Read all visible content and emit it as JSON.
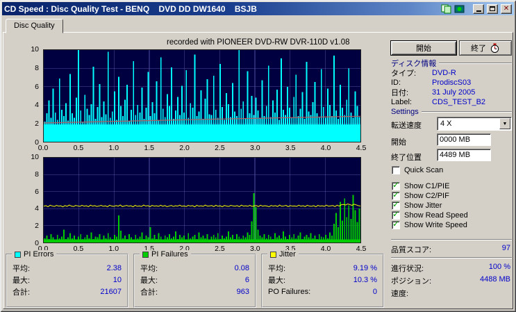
{
  "window": {
    "title": "CD Speed : Disc Quality Test - BENQ    DVD DD DW1640    BSJB",
    "controls": {
      "minimize": "minimize",
      "maximize": "maximize",
      "close": "✕"
    },
    "title_icons": [
      "pages-icon",
      "disc-drive-icon"
    ]
  },
  "tab": {
    "label": "Disc Quality"
  },
  "recorded_with": "recorded with PIONEER DVD-RW  DVR-110D v1.08",
  "buttons": {
    "start": "開始",
    "exit": "終了"
  },
  "disc_info": {
    "header": "ディスク情報",
    "rows": [
      {
        "label": "タイプ:",
        "value": "DVD-R"
      },
      {
        "label": "ID:",
        "value": "ProdiscS03"
      },
      {
        "label": "日付:",
        "value": "31 July 2005"
      },
      {
        "label": "Label:",
        "value": "CDS_TEST_B2"
      }
    ]
  },
  "settings": {
    "header": "Settings",
    "speed_label": "転送速度",
    "speed_value": "4 X",
    "start_label": "開始",
    "start_value": "0000 MB",
    "end_label": "終了位置",
    "end_value": "4489 MB",
    "checkboxes": [
      {
        "label": "Quick Scan",
        "checked": false
      },
      {
        "label": "Show C1/PIE",
        "checked": true
      },
      {
        "label": "Show C2/PIF",
        "checked": true
      },
      {
        "label": "Show Jitter",
        "checked": true
      },
      {
        "label": "Show Read Speed",
        "checked": true
      },
      {
        "label": "Show Write Speed",
        "checked": true
      }
    ]
  },
  "quality": {
    "label": "品質スコア:",
    "value": "97"
  },
  "status": {
    "rows": [
      {
        "label": "進行状況:",
        "value": "100 %"
      },
      {
        "label": "ポジション:",
        "value": "4488 MB"
      },
      {
        "label": "速度:",
        "value": ""
      }
    ]
  },
  "stats_boxes": [
    {
      "title": "PI Errors",
      "color": "#00ffff",
      "rows": [
        [
          "平均:",
          "2.38"
        ],
        [
          "最大:",
          "10"
        ],
        [
          "合計:",
          "21607"
        ]
      ]
    },
    {
      "title": "PI Failures",
      "color": "#00cc00",
      "rows": [
        [
          "平均:",
          "0.08"
        ],
        [
          "最大:",
          "6"
        ],
        [
          "合計:",
          "963"
        ]
      ]
    },
    {
      "title": "Jitter",
      "color": "#ffff00",
      "rows": [
        [
          "平均:",
          "9.19 %"
        ],
        [
          "最大:",
          "10.3 %"
        ],
        [
          "PO Failures:",
          "0"
        ]
      ]
    }
  ],
  "chart_data": [
    {
      "type": "bar",
      "title": "PI Errors (C1/PIE) with write speed line",
      "xlim": [
        0,
        4.5
      ],
      "ylim": [
        0,
        10
      ],
      "x_ticks": [
        "0.0",
        "0.5",
        "1.0",
        "1.5",
        "2.0",
        "2.5",
        "3.0",
        "3.5",
        "4.0",
        "4.5"
      ],
      "y_ticks": [
        "10",
        "8",
        "6",
        "4",
        "2",
        "0"
      ],
      "bg": "#000040",
      "grid": "#5050a0",
      "bar_color": "#00ffff",
      "base_level": 1.9,
      "values": [
        2.2,
        3.1,
        4.5,
        2.6,
        5.8,
        3.2,
        2.4,
        6.9,
        3.5,
        2.8,
        4.2,
        2.3,
        7.4,
        3.1,
        2.6,
        4.8,
        10,
        3.4,
        2.2,
        5.1,
        3.6,
        2.9,
        4.1,
        8.2,
        2.5,
        3.8,
        6.3,
        2.7,
        4.4,
        3.0,
        9.8,
        2.6,
        3.3,
        5.5,
        2.4,
        7.1,
        3.9,
        2.8,
        4.6,
        6.2,
        2.3,
        3.5,
        8.8,
        2.9,
        4.0,
        3.2,
        5.9,
        2.5,
        3.7,
        7.6,
        2.8,
        4.3,
        3.1,
        6.6,
        2.4,
        9.2,
        3.6,
        2.7,
        5.2,
        3.9,
        8.1,
        2.5,
        3.4,
        4.9,
        2.9,
        6.1,
        3.2,
        7.8,
        2.6,
        4.2,
        3.7,
        9.5,
        2.8,
        3.3,
        5.6,
        2.5,
        4.7,
        6.8,
        3.0,
        2.9,
        7.2,
        3.5,
        2.6,
        8.5,
        3.8,
        2.4,
        5.3,
        4.1,
        2.7,
        6.4,
        3.3,
        2.8,
        10,
        3.6,
        4.4,
        2.5,
        7.7,
        3.1,
        5.0,
        2.9,
        4.8,
        3.4,
        2.6,
        6.7,
        2.8,
        3.9,
        8.3,
        2.7,
        4.5,
        3.2,
        5.7,
        2.4,
        9.1,
        3.5,
        2.9,
        6.0,
        3.7,
        2.6,
        4.9,
        7.3,
        2.8,
        3.6,
        5.4,
        2.5,
        8.7,
        3.3,
        2.9,
        4.3,
        6.5,
        3.1,
        2.7,
        7.9,
        3.8,
        2.6,
        5.8,
        4.0,
        2.8,
        9.4,
        3.4,
        2.5,
        6.2,
        3.7,
        2.9,
        4.6,
        8.0,
        3.2,
        2.6,
        5.5,
        3.9,
        2.7
      ],
      "speed_line": {
        "name": "Write Speed",
        "color": "#b06060",
        "points": [
          [
            0,
            2.05
          ],
          [
            2.25,
            2.44
          ],
          [
            4.5,
            2.78
          ]
        ]
      }
    },
    {
      "type": "bar",
      "title": "PI Failures (C2/PIF) with Jitter line",
      "xlim": [
        0,
        4.5
      ],
      "ylim": [
        0,
        10
      ],
      "x_ticks": [
        "0.0",
        "0.5",
        "1.0",
        "1.5",
        "2.0",
        "2.5",
        "3.0",
        "3.5",
        "4.0",
        "4.5"
      ],
      "y_ticks": [
        "10",
        "8",
        "6",
        "4",
        "2",
        "0"
      ],
      "bg": "#000040",
      "grid": "#5050a0",
      "bar_color": "#00cc00",
      "base_level": 0.35,
      "values": [
        0.5,
        0.8,
        0.4,
        1.0,
        0.6,
        0.3,
        0.9,
        0.5,
        0.7,
        1.5,
        0.4,
        0.6,
        1.1,
        0.5,
        0.8,
        0.3,
        0.7,
        1.0,
        0.4,
        0.6,
        0.9,
        0.5,
        1.2,
        0.4,
        0.7,
        0.6,
        1.0,
        0.3,
        0.8,
        0.5,
        1.1,
        0.6,
        0.4,
        0.9,
        0.7,
        3.2,
        1.4,
        0.5,
        0.8,
        0.4,
        1.0,
        0.6,
        0.3,
        0.9,
        0.5,
        0.7,
        1.2,
        0.4,
        0.8,
        0.6,
        1.8,
        0.5,
        0.9,
        0.4,
        1.1,
        0.7,
        0.3,
        0.8,
        0.6,
        1.0,
        0.5,
        0.7,
        1.3,
        0.4,
        0.9,
        0.6,
        0.8,
        0.3,
        1.1,
        0.5,
        0.7,
        0.9,
        0.4,
        1.2,
        0.6,
        0.8,
        0.5,
        1.0,
        0.3,
        0.7,
        0.9,
        0.6,
        1.1,
        0.4,
        0.8,
        0.5,
        0.7,
        1.3,
        0.6,
        0.9,
        0.4,
        1.0,
        0.7,
        0.5,
        0.8,
        0.6,
        1.2,
        0.9,
        2.5,
        5.8,
        4.2,
        1.5,
        0.8,
        0.6,
        1.0,
        0.5,
        0.9,
        0.7,
        0.4,
        1.1,
        0.6,
        0.8,
        0.5,
        1.3,
        0.7,
        0.4,
        0.9,
        0.6,
        1.0,
        0.5,
        0.8,
        1.2,
        0.4,
        0.7,
        0.9,
        0.6,
        1.1,
        0.5,
        0.8,
        0.4,
        1.0,
        0.7,
        0.6,
        0.9,
        0.5,
        1.2,
        0.8,
        2.2,
        3.5,
        1.8,
        4.8,
        2.6,
        5.2,
        3.0,
        4.4,
        2.8,
        5.6,
        3.8,
        2.4,
        4.0
      ],
      "line": {
        "name": "Jitter",
        "color": "#ffff00",
        "values": [
          4.28,
          4.35,
          4.22,
          4.4,
          4.31,
          4.25,
          4.38,
          4.29,
          4.33,
          4.21,
          4.36,
          4.27,
          4.42,
          4.3,
          4.24,
          4.37,
          4.32,
          4.26,
          4.39,
          4.28,
          4.34,
          4.23,
          4.41,
          4.29,
          4.35,
          4.25,
          4.31,
          4.38,
          4.27,
          4.33,
          4.22,
          4.4,
          4.3,
          4.26,
          4.36,
          4.29,
          4.43,
          4.24,
          4.32,
          4.37,
          4.28,
          4.34,
          4.21,
          4.39,
          4.27,
          4.31,
          4.25,
          4.42,
          4.3,
          4.35,
          4.23,
          4.38,
          4.29,
          4.33,
          4.26,
          4.4,
          4.28,
          4.36,
          4.22,
          4.31,
          4.37,
          4.25,
          4.34,
          4.29,
          4.41,
          4.27,
          4.32,
          4.24,
          4.38,
          4.3,
          4.35,
          4.21,
          4.39,
          4.28,
          4.33,
          4.26,
          4.42,
          4.29,
          4.31,
          4.36,
          4.24,
          4.4,
          4.27,
          4.34,
          4.22,
          4.37,
          4.3,
          4.25,
          4.38,
          4.32,
          4.28,
          4.35,
          4.23,
          4.41,
          4.29,
          4.33,
          4.27,
          4.39,
          4.26,
          4.31,
          4.36,
          4.24,
          4.4,
          4.28,
          4.34,
          4.3,
          4.22,
          4.37,
          4.29,
          4.35,
          4.25,
          4.42,
          4.27,
          4.32,
          4.38,
          4.23,
          4.36,
          4.29,
          4.31,
          4.26,
          4.4,
          4.28,
          4.34,
          4.24,
          4.39,
          4.3,
          4.27,
          4.35,
          4.22,
          4.38,
          4.29,
          4.33,
          4.26,
          4.41,
          4.28,
          4.32,
          4.36,
          4.24,
          4.4,
          4.3,
          4.45,
          4.5,
          4.42,
          4.55,
          4.48,
          4.38,
          4.52,
          4.44,
          4.35,
          4.3
        ]
      }
    }
  ]
}
